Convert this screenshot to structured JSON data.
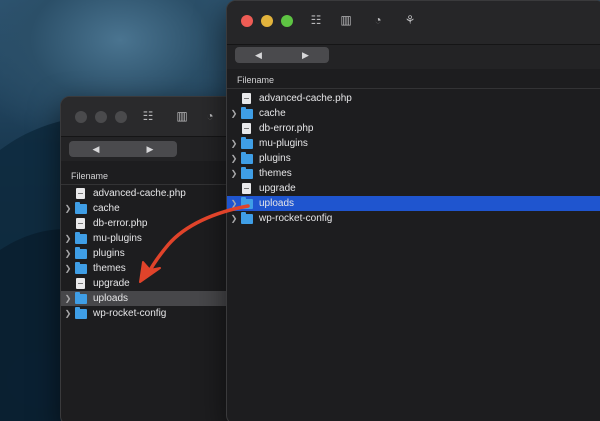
{
  "back_window": {
    "header": "Filename",
    "nav": {
      "back": "◀",
      "forward": "▶"
    },
    "items": [
      {
        "name": "advanced-cache.php",
        "type": "file",
        "expandable": false,
        "selected": false
      },
      {
        "name": "cache",
        "type": "folder",
        "expandable": true,
        "selected": false
      },
      {
        "name": "db-error.php",
        "type": "file",
        "expandable": false,
        "selected": false
      },
      {
        "name": "mu-plugins",
        "type": "folder",
        "expandable": true,
        "selected": false
      },
      {
        "name": "plugins",
        "type": "folder",
        "expandable": true,
        "selected": false
      },
      {
        "name": "themes",
        "type": "folder",
        "expandable": true,
        "selected": false
      },
      {
        "name": "upgrade",
        "type": "file",
        "expandable": false,
        "selected": false
      },
      {
        "name": "uploads",
        "type": "folder",
        "expandable": true,
        "selected": true
      },
      {
        "name": "wp-rocket-config",
        "type": "folder",
        "expandable": true,
        "selected": false
      }
    ]
  },
  "front_window": {
    "header": "Filename",
    "nav": {
      "back": "◀",
      "forward": "▶"
    },
    "toolbar_icons": [
      "outline-view-icon",
      "bookmarks-icon",
      "history-icon",
      "sync-icon"
    ],
    "items": [
      {
        "name": "advanced-cache.php",
        "type": "file",
        "expandable": false,
        "selected": false
      },
      {
        "name": "cache",
        "type": "folder",
        "expandable": true,
        "selected": false
      },
      {
        "name": "db-error.php",
        "type": "file",
        "expandable": false,
        "selected": false
      },
      {
        "name": "mu-plugins",
        "type": "folder",
        "expandable": true,
        "selected": false
      },
      {
        "name": "plugins",
        "type": "folder",
        "expandable": true,
        "selected": false
      },
      {
        "name": "themes",
        "type": "folder",
        "expandable": true,
        "selected": false
      },
      {
        "name": "upgrade",
        "type": "file",
        "expandable": false,
        "selected": false
      },
      {
        "name": "uploads",
        "type": "folder",
        "expandable": true,
        "selected": true
      },
      {
        "name": "wp-rocket-config",
        "type": "folder",
        "expandable": true,
        "selected": false
      }
    ]
  },
  "colors": {
    "selection_blue": "#1f55cf",
    "selection_grey": "#47474a",
    "folder": "#3f9ee6",
    "arrow": "#e0432a"
  }
}
